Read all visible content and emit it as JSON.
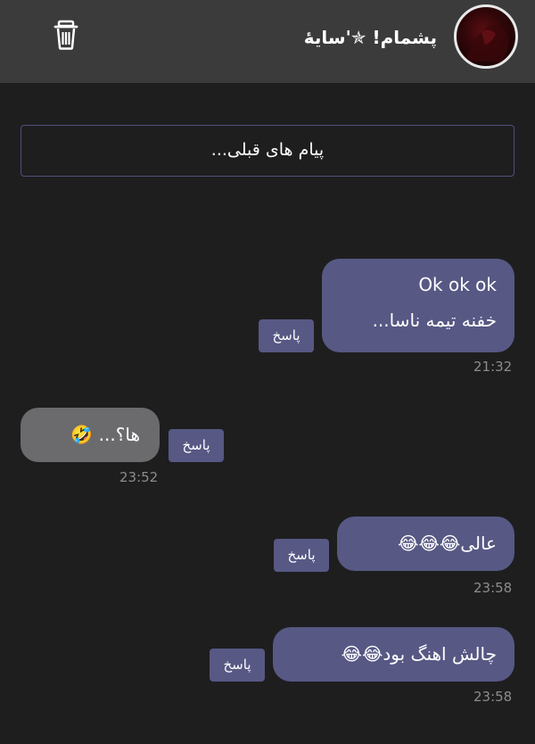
{
  "header": {
    "title": "پشمام! ✯'سایهٔ",
    "avatar_icon": "avatar-image",
    "delete_icon": "trash-icon"
  },
  "older_messages_label": "پیام های قبلی...",
  "messages": [
    {
      "direction": "outgoing",
      "lines": [
        "Ok ok ok",
        "خفنه تیمه ناسا..."
      ],
      "reply_label": "پاسخ",
      "time": "21:32"
    },
    {
      "direction": "incoming",
      "text": "ها؟... 🤣",
      "reply_label": "پاسخ",
      "time": "23:52"
    },
    {
      "direction": "outgoing",
      "text": "عالی😂😂😂",
      "reply_label": "پاسخ",
      "time": "23:58"
    },
    {
      "direction": "outgoing",
      "text": "چالش اهنگ بود😂😂",
      "reply_label": "پاسخ",
      "time": "23:58"
    }
  ],
  "colors": {
    "background": "#1e1e1f",
    "header": "#3b3b3c",
    "outgoing_bubble": "#575884",
    "incoming_bubble": "#6b6b6d",
    "timestamp": "#8c8c8e"
  }
}
